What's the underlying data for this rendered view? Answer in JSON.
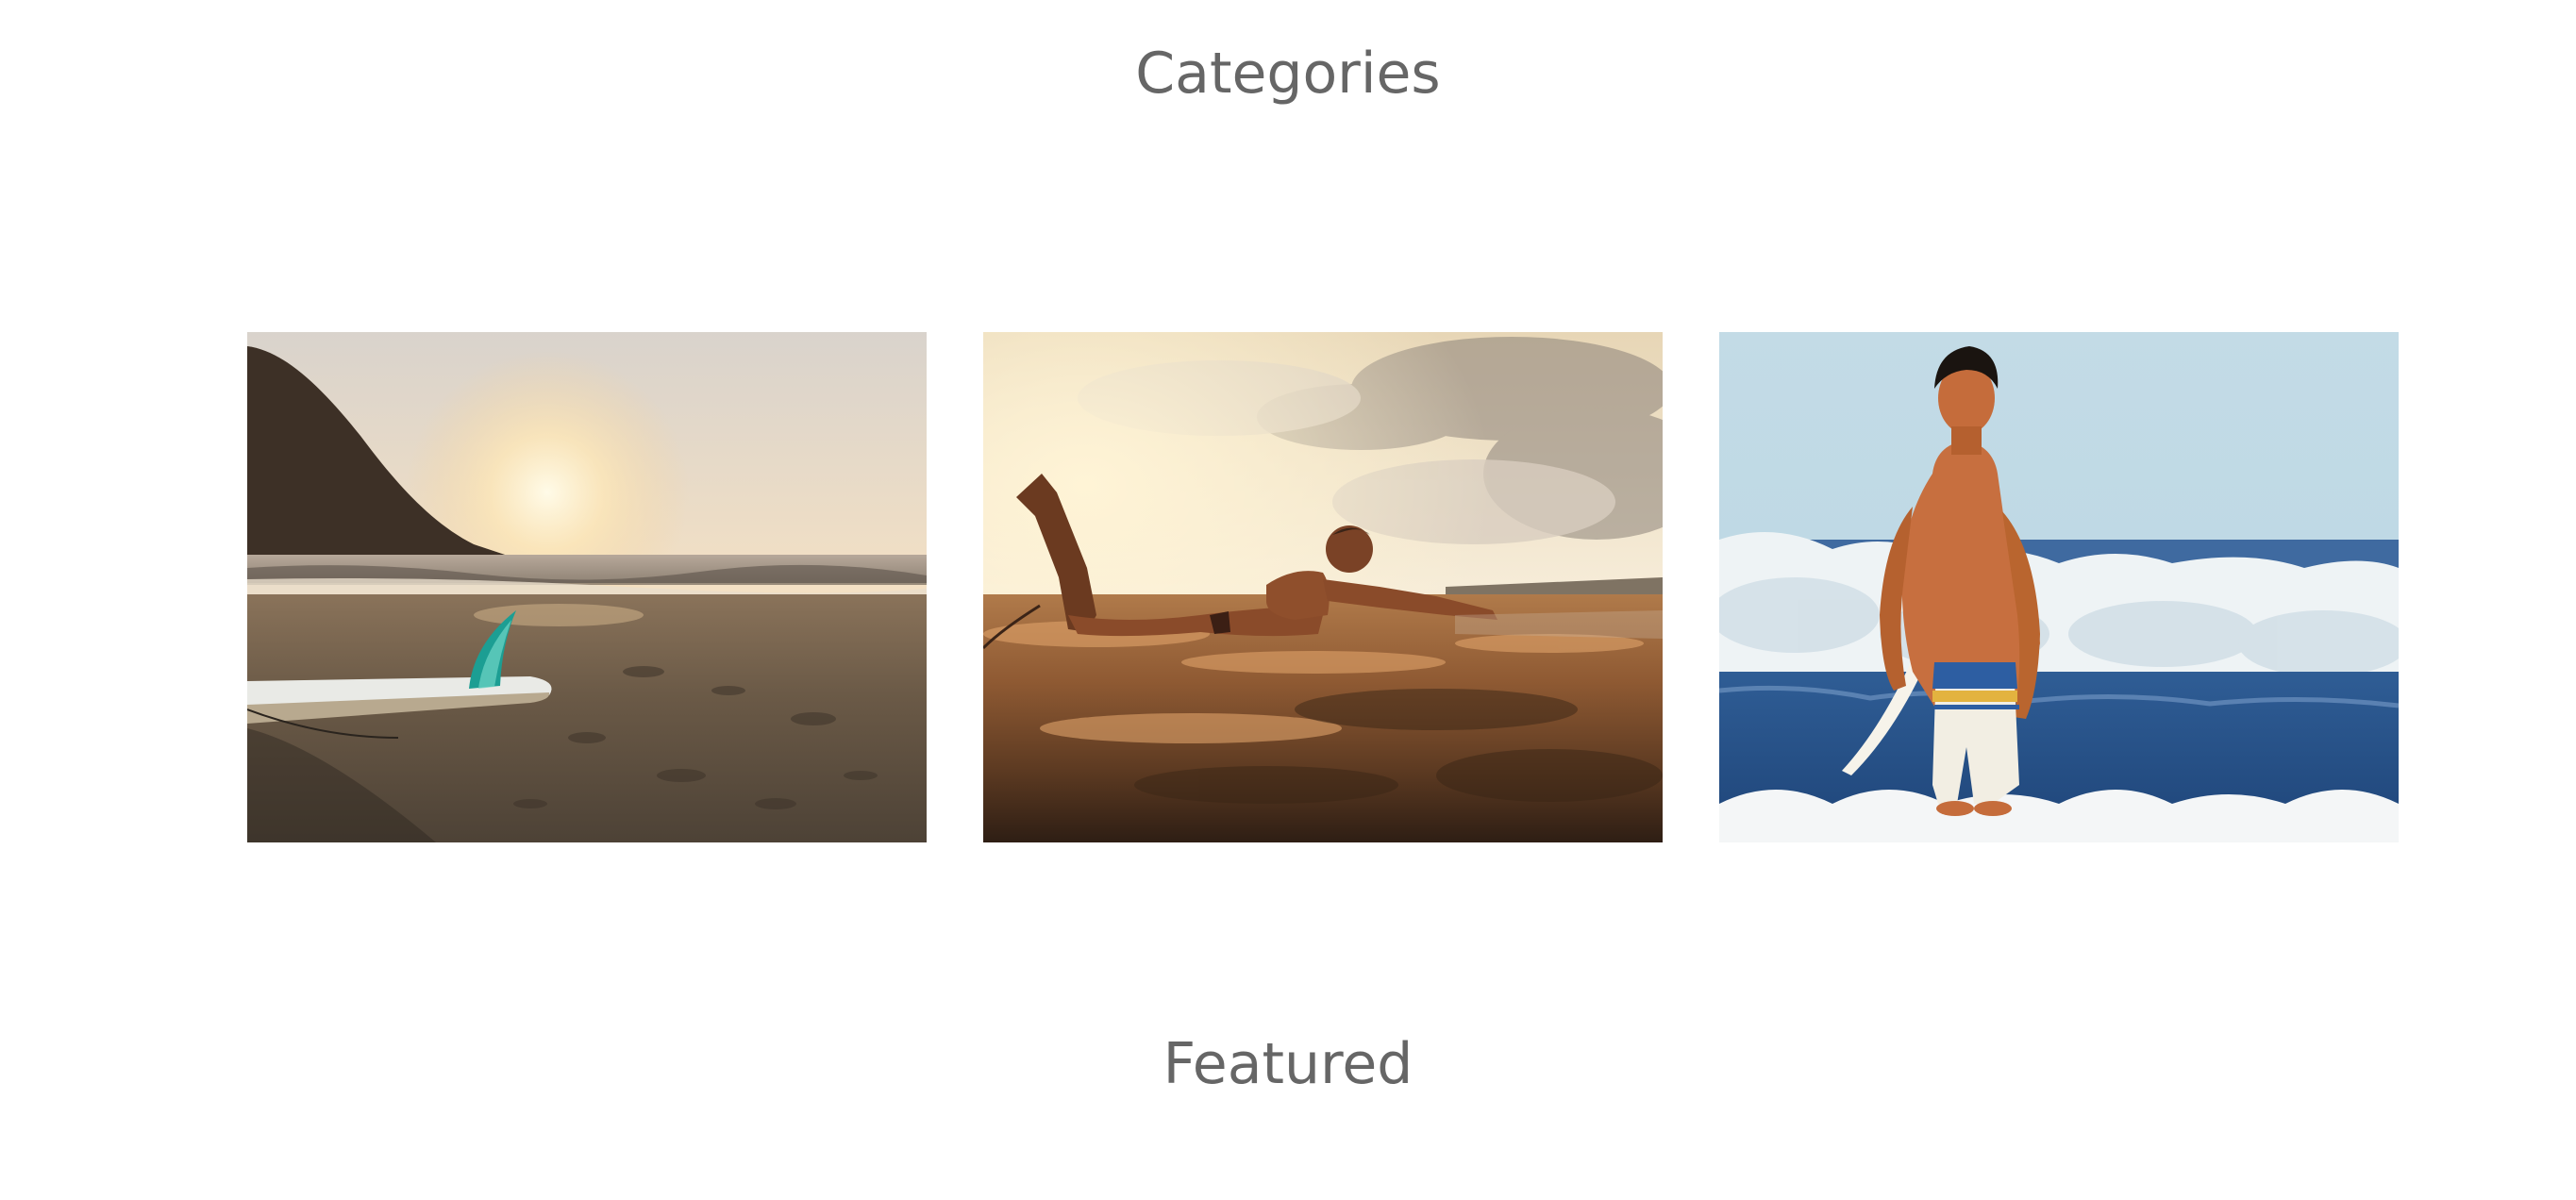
{
  "sections": {
    "categories_title": "Categories",
    "featured_title": "Featured"
  },
  "categories": [
    {
      "image": "surfboard-on-beach-at-sunset"
    },
    {
      "image": "woman-lying-on-surfboard-in-water"
    },
    {
      "image": "man-carrying-surfboard-in-waves"
    }
  ]
}
